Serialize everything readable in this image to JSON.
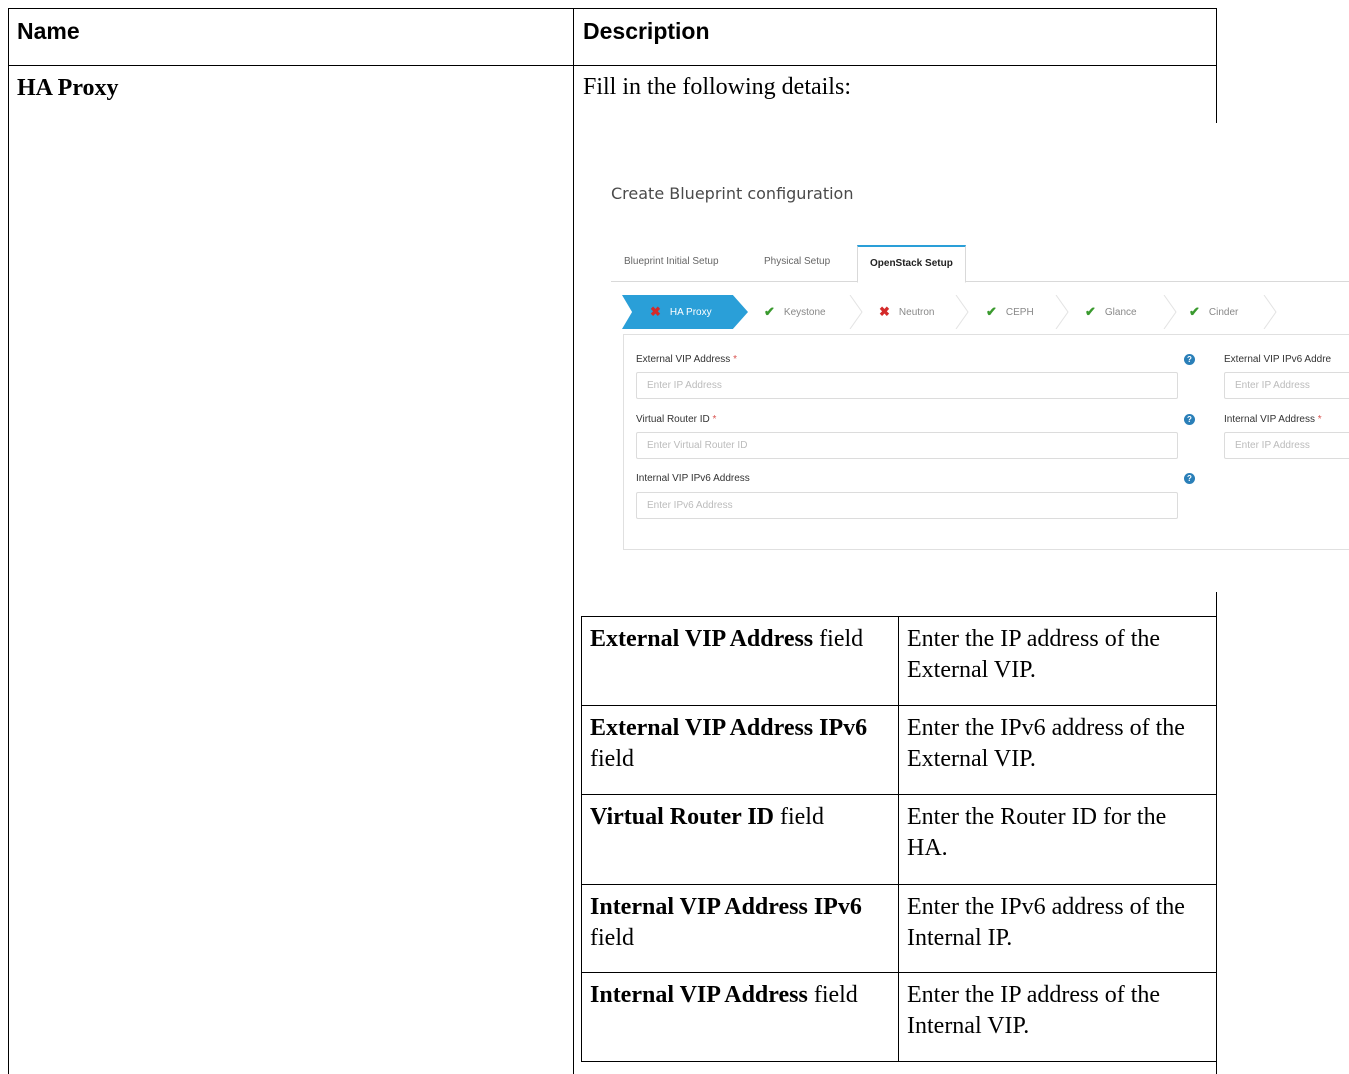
{
  "table": {
    "headers": {
      "name": "Name",
      "description": "Description"
    },
    "row": {
      "name": "HA Proxy",
      "intro": "Fill in the following details:"
    }
  },
  "screenshot": {
    "title": "Create Blueprint configuration",
    "tabs": [
      "Blueprint Initial Setup",
      "Physical Setup",
      "OpenStack Setup"
    ],
    "active_tab": "OpenStack Setup",
    "steps": [
      {
        "label": "HA Proxy",
        "status": "error",
        "icon": "x-icon"
      },
      {
        "label": "Keystone",
        "status": "ok",
        "icon": "check-icon"
      },
      {
        "label": "Neutron",
        "status": "error",
        "icon": "x-icon"
      },
      {
        "label": "CEPH",
        "status": "ok",
        "icon": "check-icon"
      },
      {
        "label": "Glance",
        "status": "ok",
        "icon": "check-icon"
      },
      {
        "label": "Cinder",
        "status": "ok",
        "icon": "check-icon"
      }
    ],
    "fields": {
      "external_vip": {
        "label": "External VIP Address",
        "required": "*",
        "placeholder": "Enter IP Address"
      },
      "external_vip_ipv6": {
        "label": "External VIP IPv6 Addre",
        "placeholder": "Enter IP Address"
      },
      "virtual_router": {
        "label": "Virtual Router ID",
        "required": "*",
        "placeholder": "Enter Virtual Router ID"
      },
      "internal_vip": {
        "label": "Internal VIP Address",
        "required": "*",
        "placeholder": "Enter IP Address"
      },
      "internal_vip_ipv6": {
        "label": "Internal VIP IPv6 Address",
        "placeholder": "Enter IPv6 Address"
      }
    },
    "colors": {
      "accent": "#2a9fd8",
      "ok": "#3a9a2e",
      "error": "#d42a2a",
      "info": "#2a7fb8"
    }
  },
  "inner_table": [
    {
      "field_bold": "External VIP Address",
      "field_rest": " field",
      "desc": [
        "Enter the IP address of the",
        "External VIP."
      ]
    },
    {
      "field_bold": "External VIP Address IPv6",
      "field_rest": "field",
      "desc": [
        "Enter the IPv6 address of the",
        "External VIP."
      ]
    },
    {
      "field_bold": "Virtual Router ID",
      "field_rest": " field",
      "desc": [
        "Enter the Router ID for the",
        "HA."
      ]
    },
    {
      "field_bold": "Internal VIP Address IPv6",
      "field_rest": "field",
      "desc": [
        "Enter the IPv6 address of the",
        "Internal IP."
      ]
    },
    {
      "field_bold": "Internal VIP Address",
      "field_rest": " field",
      "desc": [
        "Enter the IP address of the",
        "Internal VIP."
      ]
    }
  ]
}
